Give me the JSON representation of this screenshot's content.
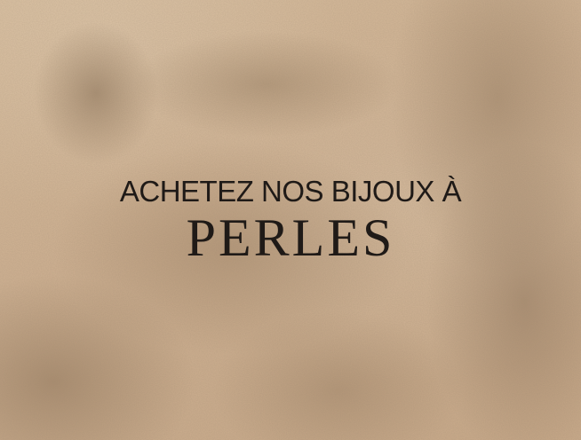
{
  "banner": {
    "headline_line1": "ACHETEZ NOS BIJOUX À",
    "headline_line2": "PERLES",
    "text_color": "#1f1a17",
    "background": "sand-texture",
    "background_color": "#d2b595"
  }
}
